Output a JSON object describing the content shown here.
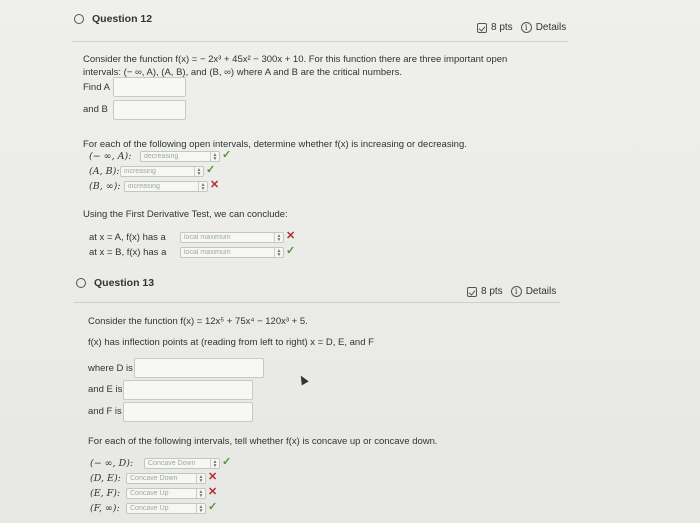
{
  "q12": {
    "title": "Question 12",
    "points": "8 pts",
    "details": "Details",
    "intro_1": "Consider the function f(x) = − 2x³ + 45x² − 300x + 10. For this function there are three important open",
    "intro_2": "intervals: (− ∞, A), (A, B), and (B, ∞) where A and B are the critical numbers.",
    "find_a": "Find A",
    "and_b": "and B",
    "inc_dec_prompt": "For each of the following open intervals, determine whether f(x) is increasing or decreasing.",
    "intervals": [
      {
        "label": "(− ∞, A):",
        "value": "decreasing",
        "result": "✓"
      },
      {
        "label": "(A, B):",
        "value": "increasing",
        "result": "✓"
      },
      {
        "label": "(B, ∞):",
        "value": "increasing",
        "result": "✕"
      }
    ],
    "first_deriv_prompt": "Using the First Derivative Test, we can conclude:",
    "conclusions": [
      {
        "label": "at x = A, f(x) has a",
        "value": "local maximum",
        "result": "✕"
      },
      {
        "label": "at x = B, f(x) has a",
        "value": "local maximum",
        "result": "✓"
      }
    ]
  },
  "q13": {
    "title": "Question 13",
    "points": "8 pts",
    "details": "Details",
    "intro": "Consider the function f(x) = 12x⁵ + 75x⁴ − 120x³ + 5.",
    "inflection": "f(x) has inflection points at (reading from left to right) x = D, E, and F",
    "where_d": "where D is",
    "and_e": "and E is",
    "and_f": "and F is",
    "concavity_prompt": "For each of the following intervals, tell whether f(x) is concave up or concave down.",
    "intervals": [
      {
        "label": "(− ∞, D):",
        "value": "Concave Down",
        "result": "✓"
      },
      {
        "label": "(D, E):",
        "value": "Concave Down",
        "result": "✕"
      },
      {
        "label": "(E, F):",
        "value": "Concave Up",
        "result": "✕"
      },
      {
        "label": "(F, ∞):",
        "value": "Concave Up",
        "result": "✓"
      }
    ]
  },
  "colors": {
    "check": "#5a8f3a",
    "cross": "#b03030"
  }
}
